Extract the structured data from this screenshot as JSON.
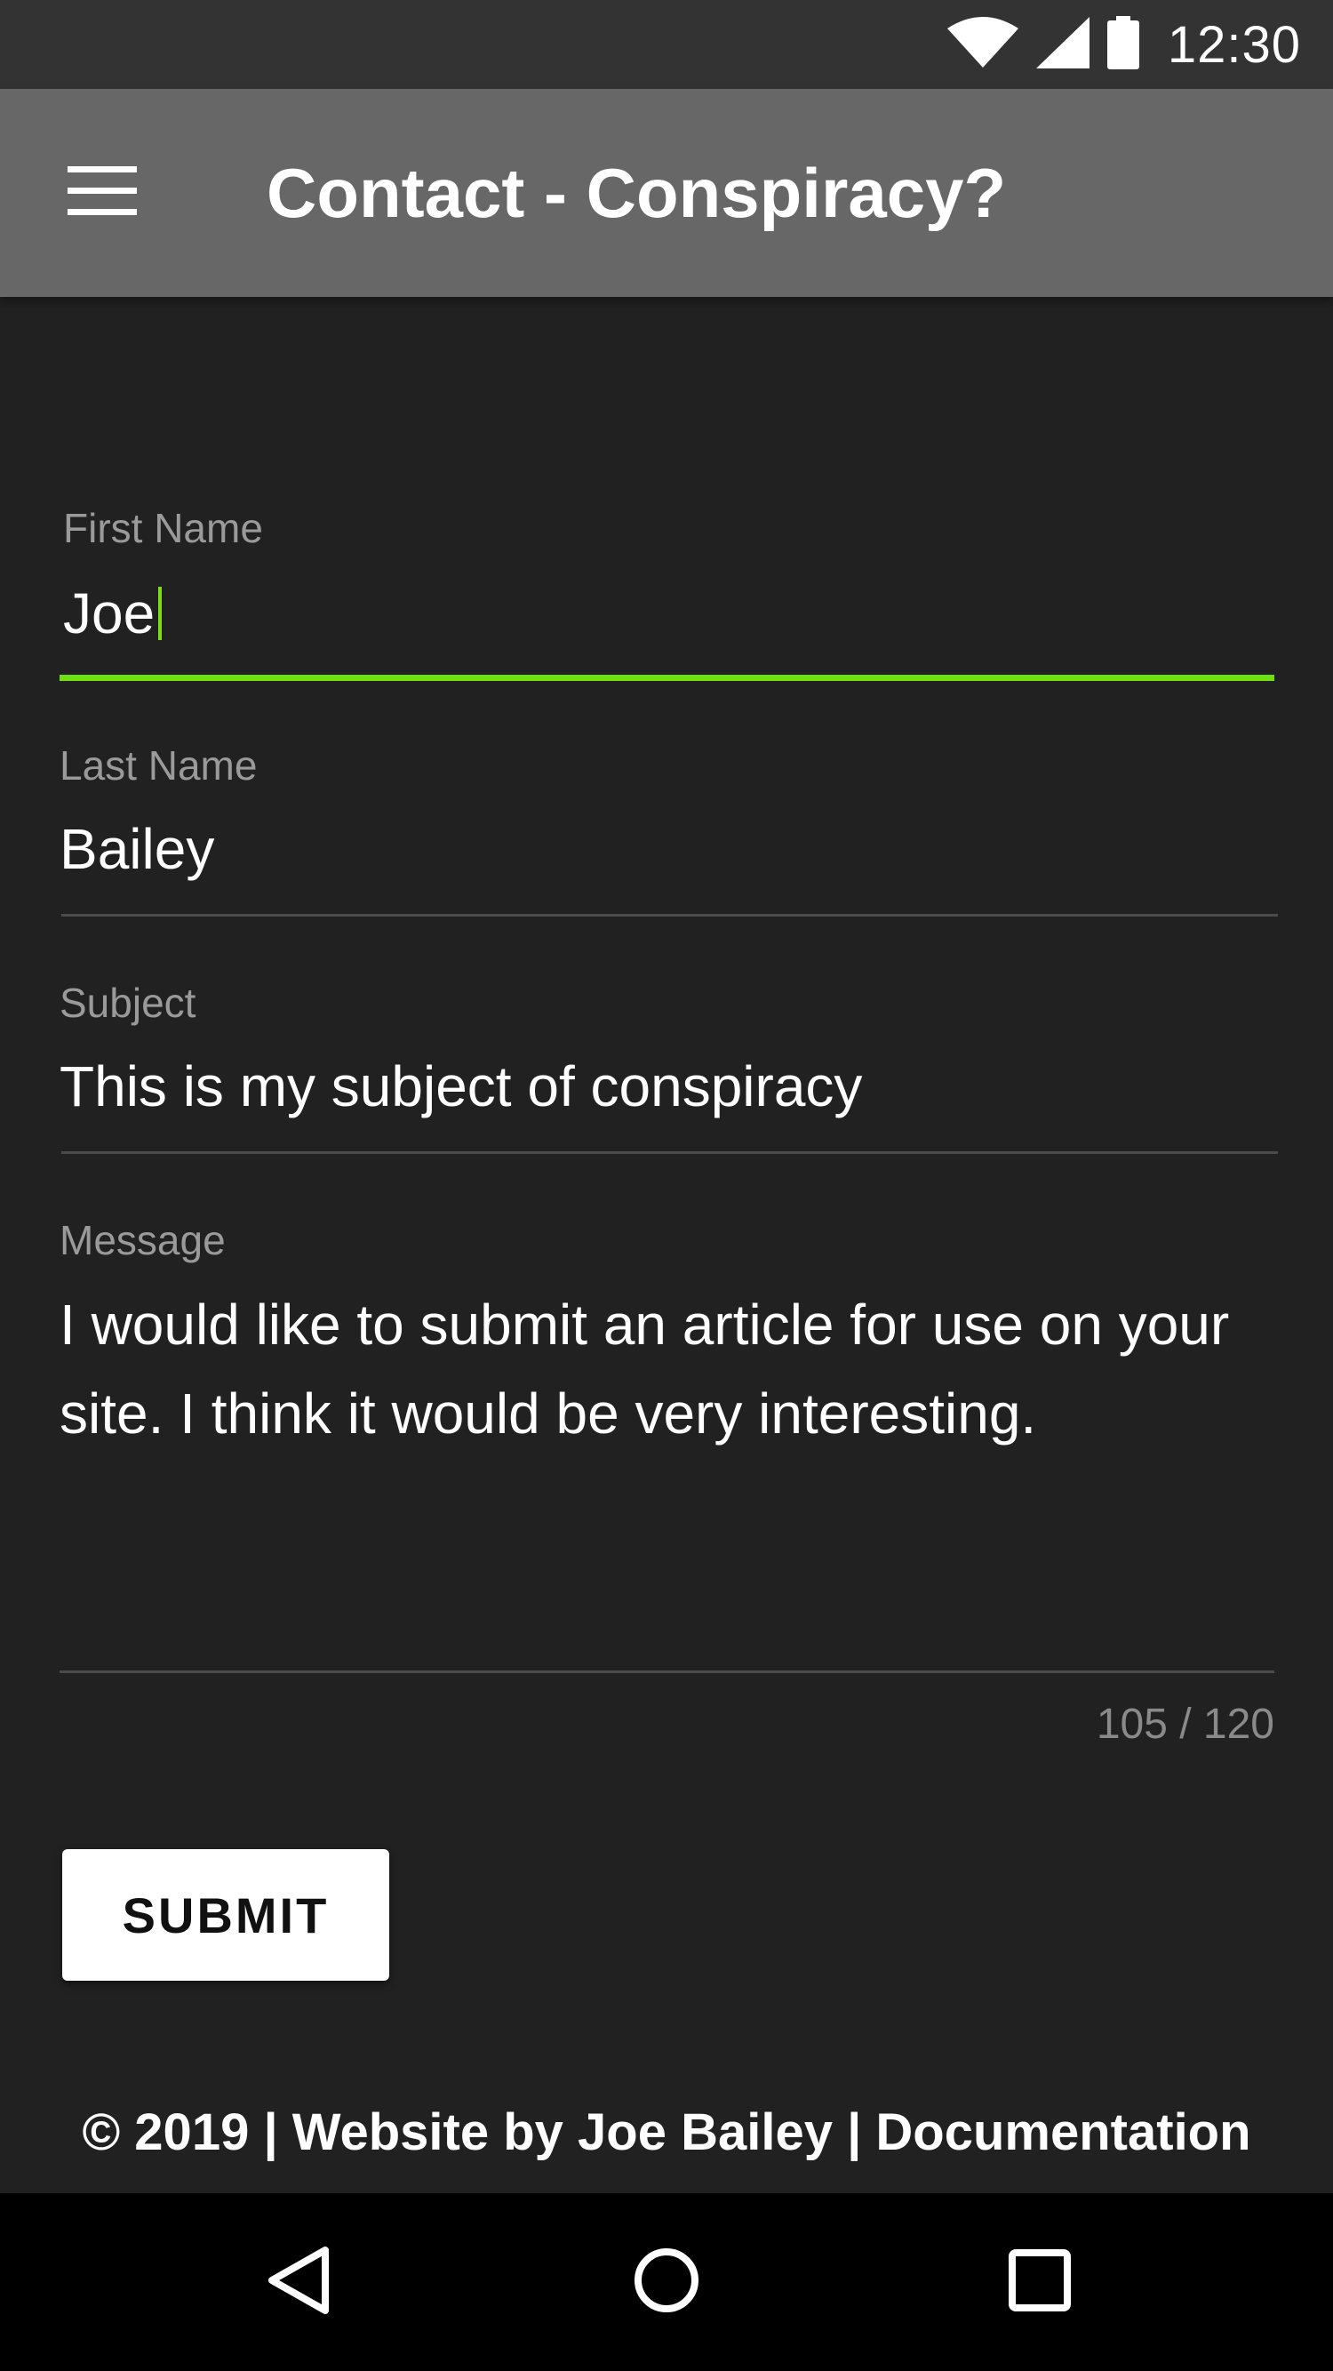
{
  "status_bar": {
    "time": "12:30",
    "icons": [
      "wifi-icon",
      "cell-signal-icon",
      "battery-icon"
    ]
  },
  "app_bar": {
    "menu_icon": "hamburger-menu-icon",
    "title": "Contact - Conspiracy?"
  },
  "form": {
    "first_name": {
      "label": "First Name",
      "value": "Joe"
    },
    "last_name": {
      "label": "Last Name",
      "value": "Bailey"
    },
    "subject": {
      "label": "Subject",
      "value": "This is my subject of conspiracy"
    },
    "message": {
      "label": "Message",
      "value": "I would like to submit an article for use on your site. I think it would be very interesting.",
      "counter": "105 / 120"
    },
    "submit_label": "SUBMIT"
  },
  "footer": {
    "text": "© 2019 | Website by Joe Bailey | Documentation"
  },
  "nav_bar": {
    "buttons": [
      "back-icon",
      "home-icon",
      "recents-icon"
    ]
  },
  "colors": {
    "background": "#212121",
    "app_bar": "#676767",
    "status_bar": "#333333",
    "accent": "#6ee011",
    "nav_bar": "#000000"
  }
}
